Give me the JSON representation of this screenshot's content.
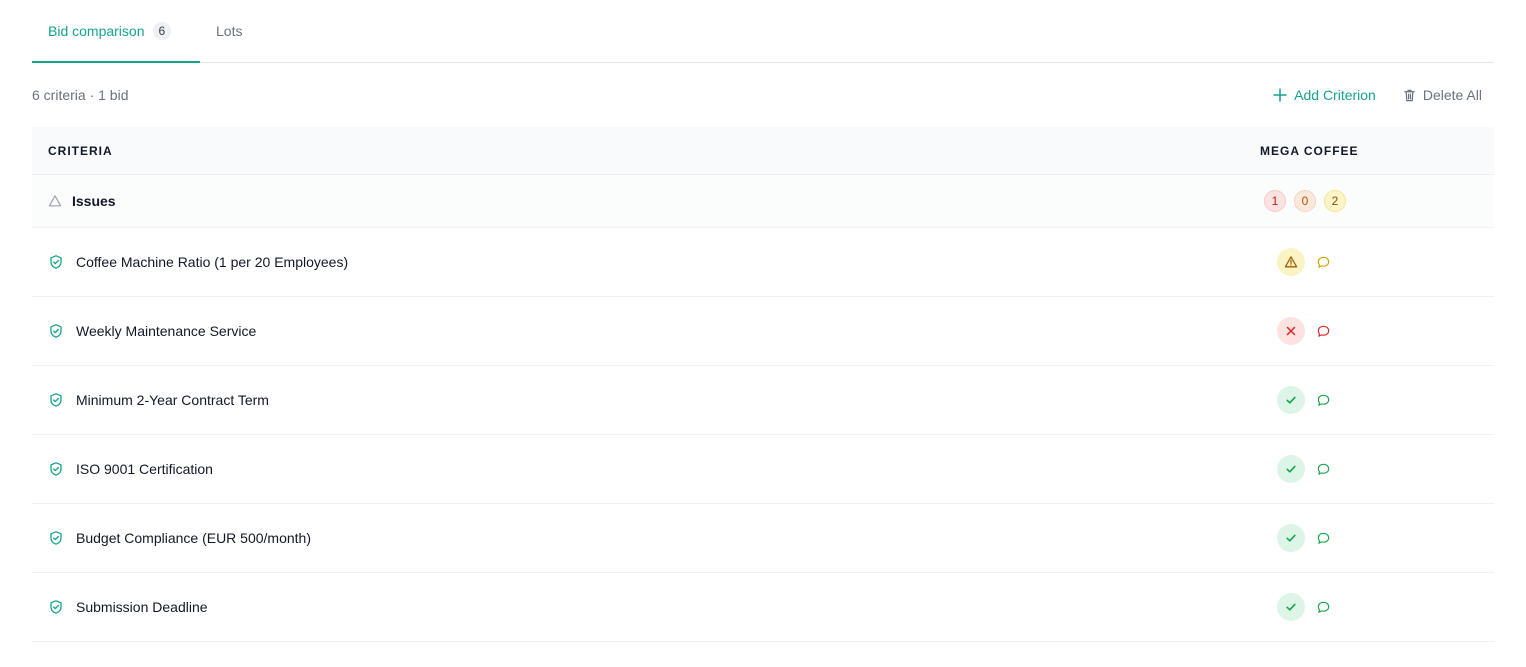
{
  "tabs": [
    {
      "label": "Bid comparison",
      "count": "6",
      "active": true
    },
    {
      "label": "Lots",
      "active": false
    }
  ],
  "toolbar": {
    "summary": "6 criteria · 1 bid",
    "add_label": "Add Criterion",
    "delete_label": "Delete All"
  },
  "table": {
    "col_criteria": "CRITERIA",
    "col_bidder": "MEGA COFFEE",
    "issues": {
      "label": "Issues",
      "counts": [
        "1",
        "0",
        "2"
      ]
    },
    "rows": [
      {
        "label": "Coffee Machine Ratio (1 per 20 Employees)",
        "status": "warning"
      },
      {
        "label": "Weekly Maintenance Service",
        "status": "fail"
      },
      {
        "label": "Minimum 2-Year Contract Term",
        "status": "pass"
      },
      {
        "label": "ISO 9001 Certification",
        "status": "pass"
      },
      {
        "label": "Budget Compliance (EUR 500/month)",
        "status": "pass"
      },
      {
        "label": "Submission Deadline",
        "status": "pass"
      }
    ]
  },
  "colors": {
    "accent": "#14a38b",
    "pass": "#16a34a",
    "fail": "#dc2626",
    "warning": "#a16207"
  },
  "icons": {
    "criterion": "shield-check-icon",
    "issues": "triangle-icon",
    "add": "plus-icon",
    "delete": "trash-icon",
    "comment": "comment-icon"
  }
}
